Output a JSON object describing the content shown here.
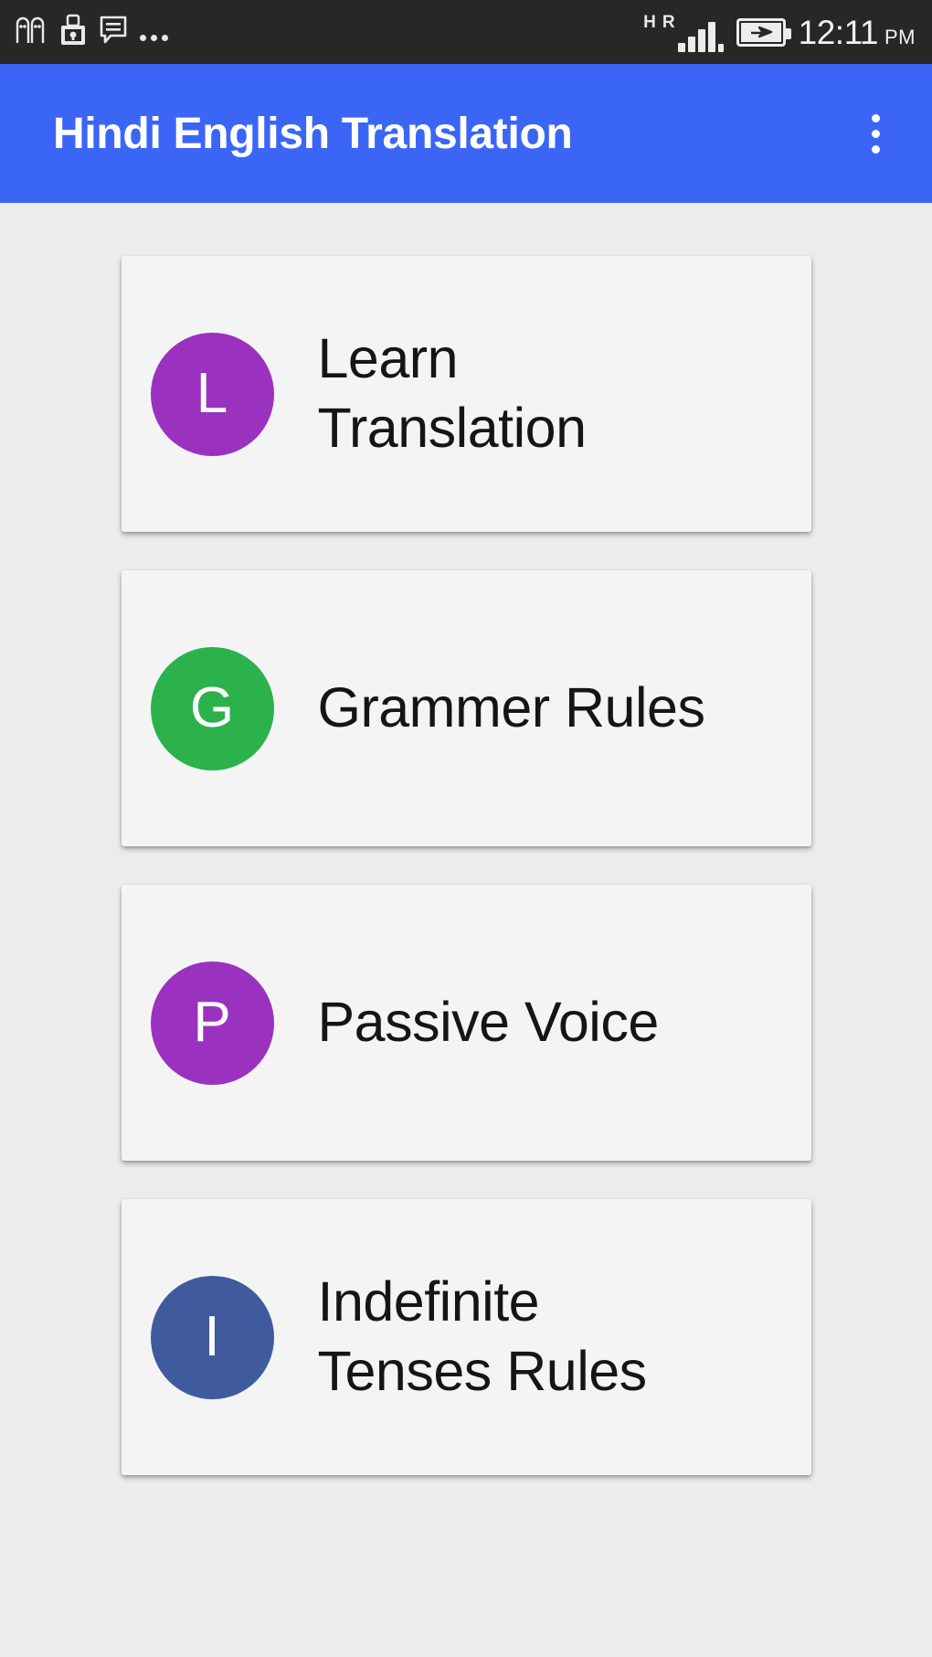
{
  "status_bar": {
    "left_icons": [
      {
        "name": "contacts-icon",
        "label": "contacts"
      },
      {
        "name": "usb-lock-icon",
        "label": "usb-lock"
      },
      {
        "name": "message-bubble-icon",
        "label": "message"
      },
      {
        "name": "more-notifications-icon",
        "label": "more"
      }
    ],
    "network_type": "H",
    "roaming": "R",
    "signal_bars": 4,
    "battery_icon": "battery-charging-icon",
    "time": "12:11",
    "meridiem": "PM",
    "background_color": "#272727"
  },
  "app_bar": {
    "title": "Hindi English Translation",
    "overflow_menu_label": "More options",
    "background_color": "#3b66f5",
    "title_color": "#ffffff"
  },
  "page": {
    "background_color": "#ececec",
    "card_background_color": "#f4f4f4"
  },
  "list": {
    "items": [
      {
        "initial": "L",
        "label": "Learn Translation",
        "avatar_color": "#9a32bf"
      },
      {
        "initial": "G",
        "label": "Grammer Rules",
        "avatar_color": "#2bb24c"
      },
      {
        "initial": "P",
        "label": "Passive Voice",
        "avatar_color": "#9a32bf"
      },
      {
        "initial": "I",
        "label": "Indefinite Tenses Rules",
        "avatar_color": "#3f5b9e"
      }
    ]
  }
}
